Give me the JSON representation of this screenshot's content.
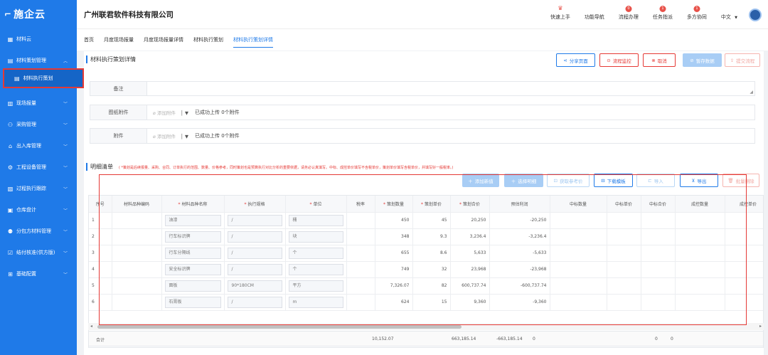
{
  "app": {
    "logo": "施企云",
    "company": "广州联君软件科技有限公司"
  },
  "topbar": {
    "quick_start": "快速上手",
    "feature_nav": "功能导航",
    "process": {
      "label": "流程办理",
      "badge": "0"
    },
    "tasks": {
      "label": "任务指派",
      "badge": "1"
    },
    "collab": {
      "label": "多方协同",
      "badge": "1"
    },
    "lang": "中文"
  },
  "sidebar": {
    "items": [
      {
        "label": "材料云",
        "icon": "grid-icon"
      },
      {
        "label": "材料策划管理",
        "icon": "document-icon"
      },
      {
        "label": "现场报量",
        "icon": "ruler-icon"
      },
      {
        "label": "采购管理",
        "icon": "people-icon"
      },
      {
        "label": "出入库管理",
        "icon": "warehouse-icon"
      },
      {
        "label": "工程设备管理",
        "icon": "gear-icon"
      },
      {
        "label": "过程执行跟踪",
        "icon": "chart-icon"
      },
      {
        "label": "仓库盘计",
        "icon": "box-icon"
      },
      {
        "label": "分包方材料管理",
        "icon": "users-icon"
      },
      {
        "label": "结付核准(供方版)",
        "icon": "check-icon"
      },
      {
        "label": "基础配置",
        "icon": "settings-icon"
      }
    ],
    "active_sub": "材料执行策划"
  },
  "tabs": [
    "首页",
    "月度现场报量",
    "月度现场报量详情",
    "材料执行策划",
    "材料执行策划详情"
  ],
  "page": {
    "title": "材料执行策划详情",
    "buttons": {
      "share": "分享页面",
      "monitor": "流程监控",
      "cancel": "取消",
      "save": "暂存数据",
      "submit": "提交流程"
    },
    "remark_label": "备注",
    "drawing_label": "图纸附件",
    "attachment_label": "附件",
    "add_attachment": "添加附件",
    "upload_info": "已成功上传 0个附件"
  },
  "detail": {
    "title": "明细清单",
    "note": "( *策划是后续报量、采购、合同、订单执行的范围、数量、价格参考，同时策划也是预算执行对比分析的重要依据，请务必认真填写。中标、成控单价填写不含税单价，策划单价填写含税单价，并填写好一般税率。)",
    "buttons": {
      "add_new": "添加新值",
      "choose": "选择明细",
      "ref_price": "获取参考价",
      "download": "下载模板",
      "import": "导入",
      "export": "导出",
      "batch_delete": "批量删除"
    },
    "columns": [
      "序号",
      "材料品种编码",
      "材料品种名称",
      "执行规格",
      "单位",
      "税率",
      "策划数量",
      "策划单价",
      "策划合价",
      "预估利润",
      "中标数量",
      "中标单价",
      "中标合价",
      "成控数量",
      "成控单价"
    ],
    "rows": [
      {
        "no": "1",
        "code": "",
        "name": "油漆",
        "spec": "/",
        "unit": "桶",
        "tax": "",
        "qty": "450",
        "price": "45",
        "total": "20,250",
        "profit": "-20,250"
      },
      {
        "no": "2",
        "code": "",
        "name": "行车标识牌",
        "spec": "/",
        "unit": "块",
        "tax": "",
        "qty": "348",
        "price": "9.3",
        "total": "3,236.4",
        "profit": "-3,236.4"
      },
      {
        "no": "3",
        "code": "",
        "name": "行车分隔线",
        "spec": "/",
        "unit": "个",
        "tax": "",
        "qty": "655",
        "price": "8.6",
        "total": "5,633",
        "profit": "-5,633"
      },
      {
        "no": "4",
        "code": "",
        "name": "安全标识牌",
        "spec": "/",
        "unit": "个",
        "tax": "",
        "qty": "749",
        "price": "32",
        "total": "23,968",
        "profit": "-23,968"
      },
      {
        "no": "5",
        "code": "",
        "name": "面板",
        "spec": "90*180CM",
        "unit": "平方",
        "tax": "",
        "qty": "7,326.07",
        "price": "82",
        "total": "600,737.74",
        "profit": "-600,737.74"
      },
      {
        "no": "6",
        "code": "",
        "name": "石膏板",
        "spec": "/",
        "unit": "m",
        "tax": "",
        "qty": "624",
        "price": "15",
        "total": "9,360",
        "profit": "-9,360"
      }
    ],
    "summary": {
      "label": "合计",
      "qty": "10,152.07",
      "total": "663,185.14",
      "profit": "-663,185.14",
      "bid_qty": "0",
      "bid_total": "0",
      "ctrl_qty": "0"
    }
  }
}
